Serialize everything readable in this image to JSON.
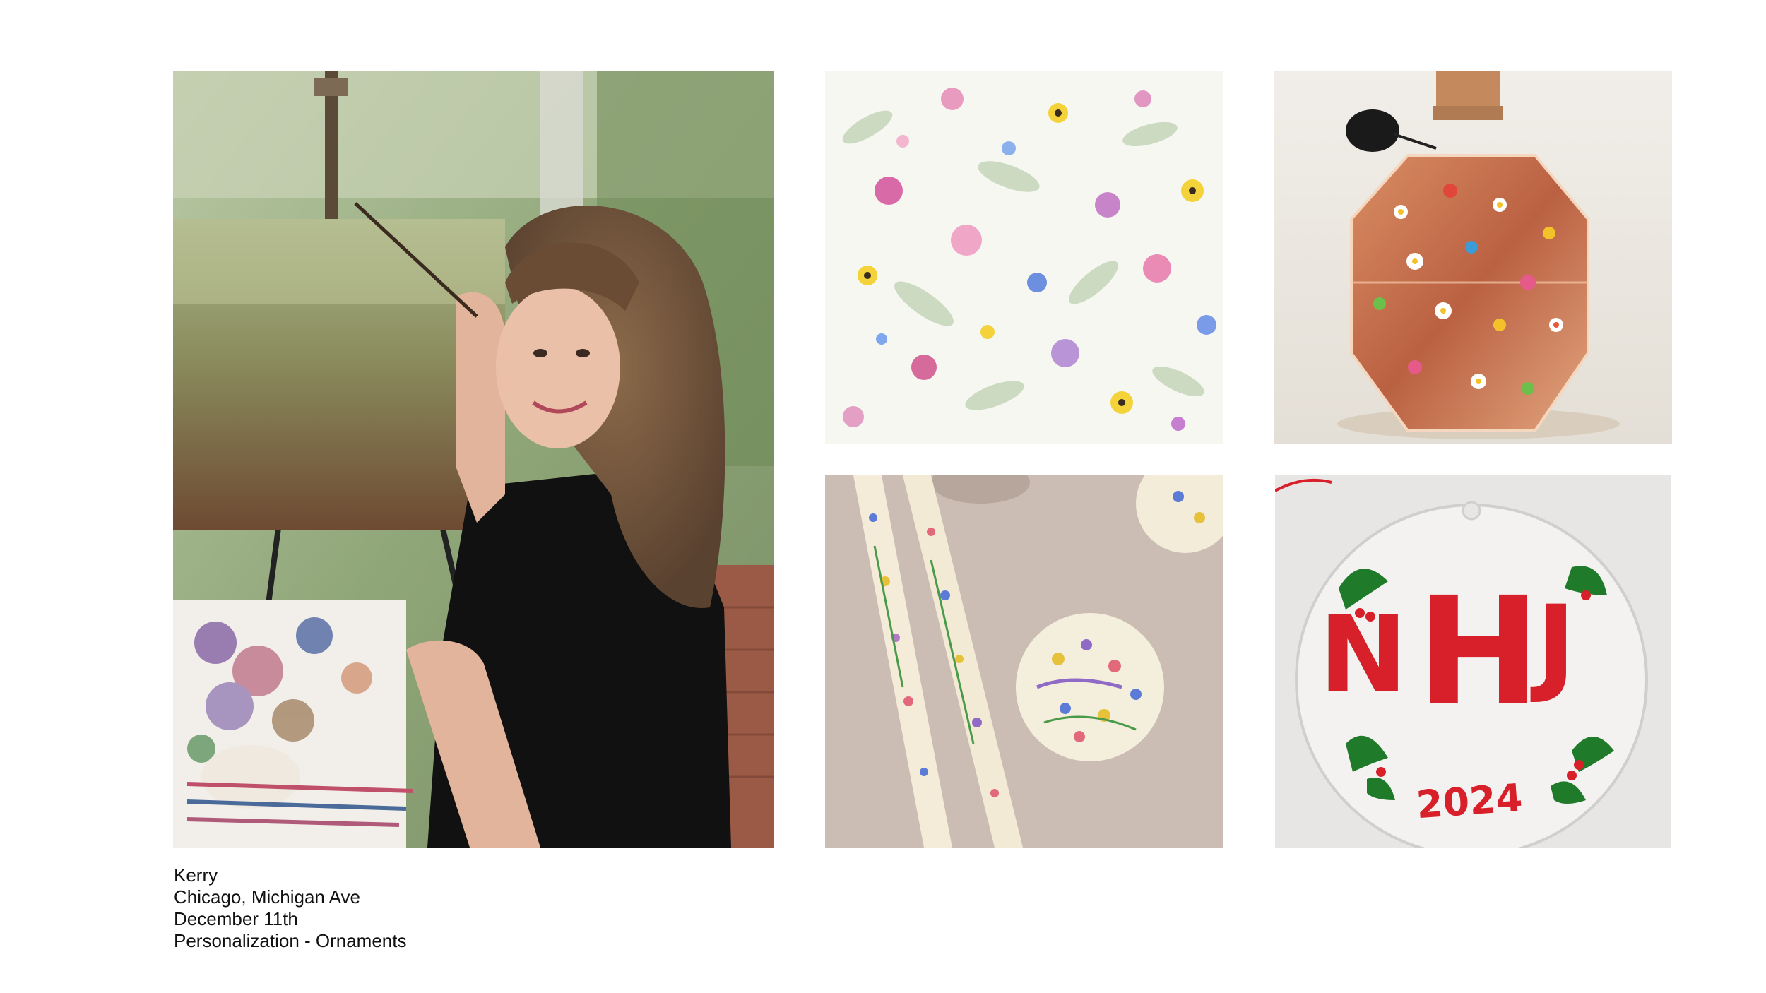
{
  "caption": {
    "name": "Kerry",
    "location": "Chicago, Michigan Ave",
    "date": "December 11th",
    "service": "Personalization - Ornaments"
  },
  "ornament": {
    "monogram_left": "N",
    "monogram_center": "H",
    "monogram_right": "J",
    "year": "2024"
  },
  "colors": {
    "background": "#ffffff",
    "caption_text": "#111111",
    "ornament_red": "#d8202a",
    "holly_green": "#1f7a2a",
    "dot_yellow": "#f5c230"
  },
  "images": [
    {
      "name": "artist-portrait",
      "description_icon": "photo-icon"
    },
    {
      "name": "floral-pattern",
      "description_icon": "photo-icon"
    },
    {
      "name": "painted-perfume-bottle",
      "description_icon": "photo-icon"
    },
    {
      "name": "painted-candles",
      "description_icon": "photo-icon"
    },
    {
      "name": "monogram-ornament",
      "description_icon": "photo-icon"
    }
  ]
}
